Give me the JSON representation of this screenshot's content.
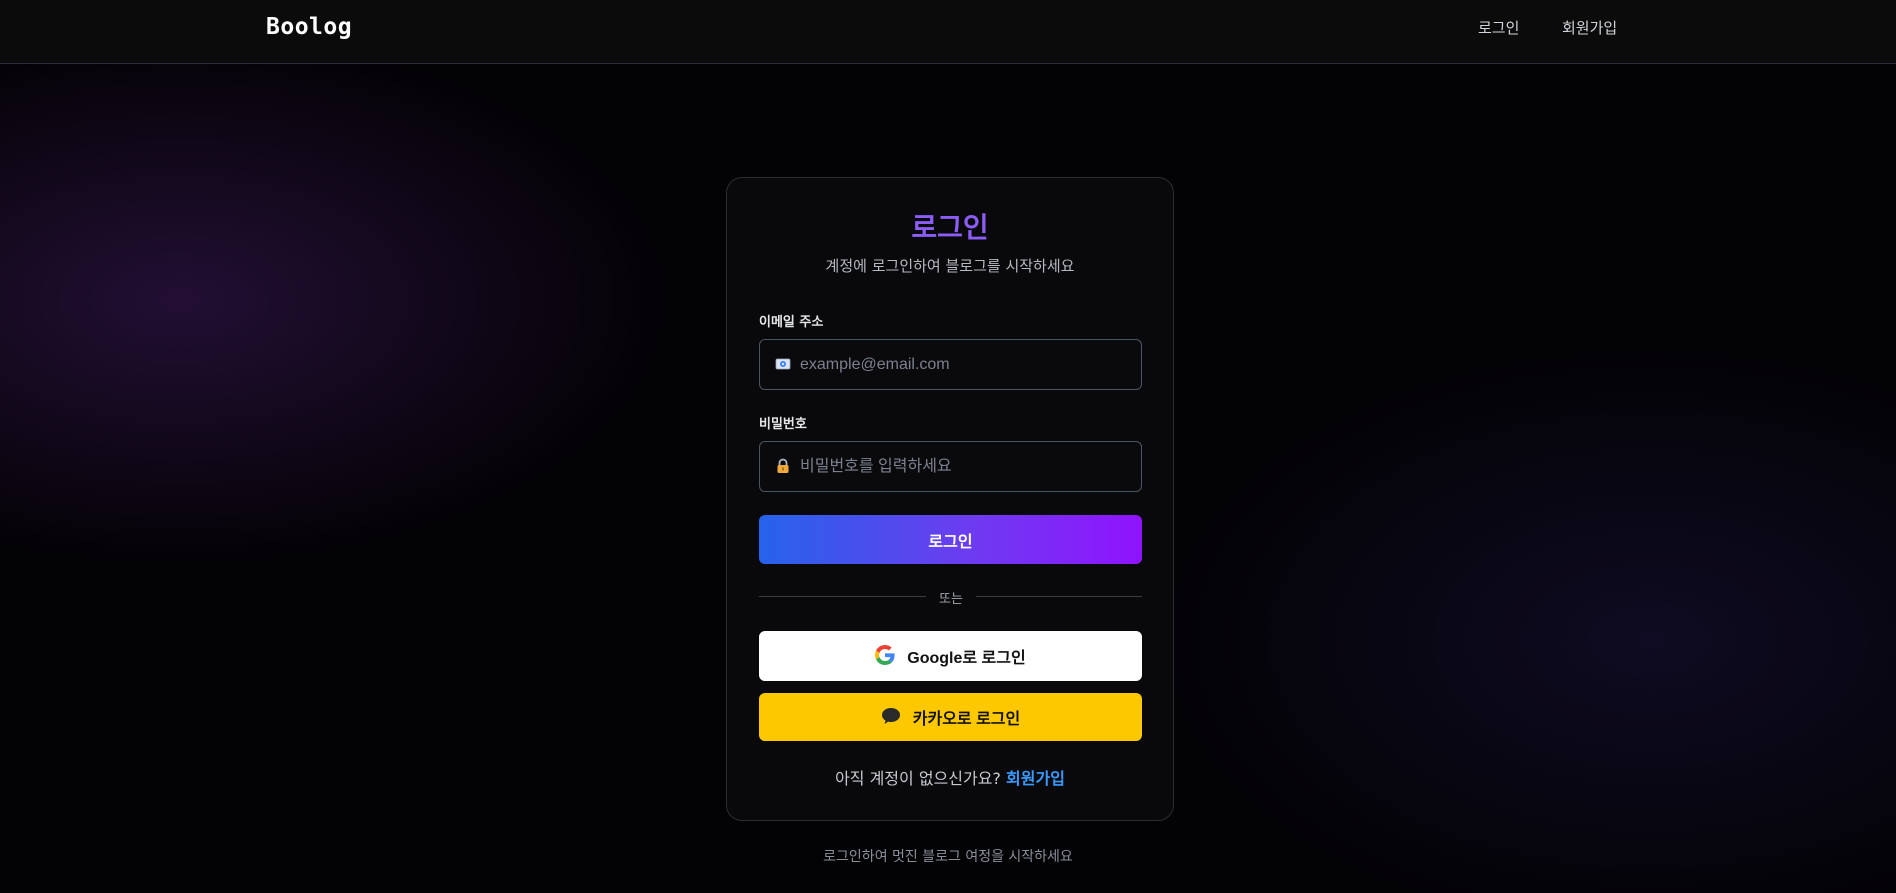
{
  "header": {
    "logo": "Boolog",
    "nav": {
      "login": "로그인",
      "signup": "회원가입"
    }
  },
  "login_card": {
    "title": "로그인",
    "subtitle": "계정에 로그인하여 블로그를 시작하세요",
    "email": {
      "label": "이메일 주소",
      "placeholder": "example@email.com",
      "value": "",
      "icon": "mail-icon"
    },
    "password": {
      "label": "비밀번호",
      "placeholder": "비밀번호를 입력하세요",
      "value": "",
      "icon": "lock-icon"
    },
    "submit_label": "로그인",
    "divider_text": "또는",
    "google_label": "Google로 로그인",
    "kakao_label": "카카오로 로그인",
    "signup_prompt": "아직 계정이 없으신가요?",
    "signup_link": "회원가입"
  },
  "footer_note": "로그인하여 멋진 블로그 여정을 시작하세요",
  "colors": {
    "accent_purple": "#8b5cf6",
    "gradient_start": "#2563eb",
    "gradient_end": "#9013fe",
    "link_blue": "#3b9cff",
    "kakao_yellow": "#fdc800"
  }
}
